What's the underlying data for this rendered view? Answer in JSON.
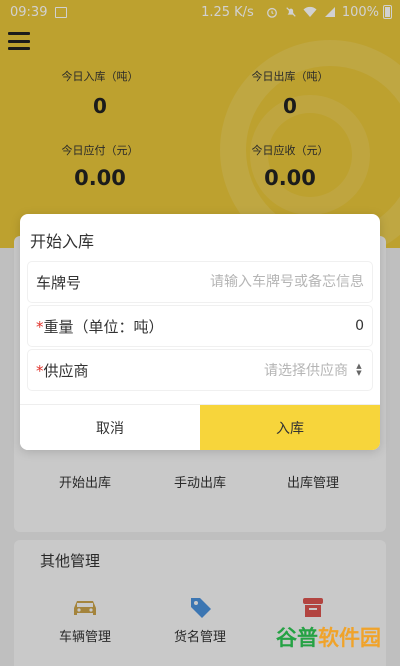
{
  "status_bar": {
    "time": "09:39",
    "speed": "1.25 K/s",
    "battery": "100%"
  },
  "stats": {
    "today_in_label": "今日入库（吨）",
    "today_in_value": "0",
    "today_out_label": "今日出库（吨）",
    "today_out_value": "0",
    "today_payable_label": "今日应付（元）",
    "today_payable_value": "0.00",
    "today_receivable_label": "今日应收（元）",
    "today_receivable_value": "0.00"
  },
  "out_grid": [
    {
      "label": "开始出库",
      "icon": "truck-out-icon"
    },
    {
      "label": "手动出库",
      "icon": "manual-out-icon"
    },
    {
      "label": "出库管理",
      "icon": "out-manage-icon"
    }
  ],
  "other_section": {
    "title": "其他管理",
    "items": [
      {
        "label": "车辆管理",
        "icon": "car-icon"
      },
      {
        "label": "货名管理",
        "icon": "tag-icon"
      },
      {
        "label": "",
        "icon": "store-icon"
      }
    ]
  },
  "dialog": {
    "title": "开始入库",
    "plate_label": "车牌号",
    "plate_placeholder": "请输入车牌号或备忘信息",
    "weight_required": "*",
    "weight_label": "重量（单位：吨）",
    "weight_value": "0",
    "supplier_required": "*",
    "supplier_label": "供应商",
    "supplier_placeholder": "请选择供应商",
    "cancel_label": "取消",
    "confirm_label": "入库"
  },
  "watermark": {
    "part1": "谷普",
    "part2": "软件园"
  },
  "colors": {
    "header_yellow": "#e7c53a",
    "confirm_yellow": "#f7d53b",
    "required_red": "#e0322b"
  }
}
